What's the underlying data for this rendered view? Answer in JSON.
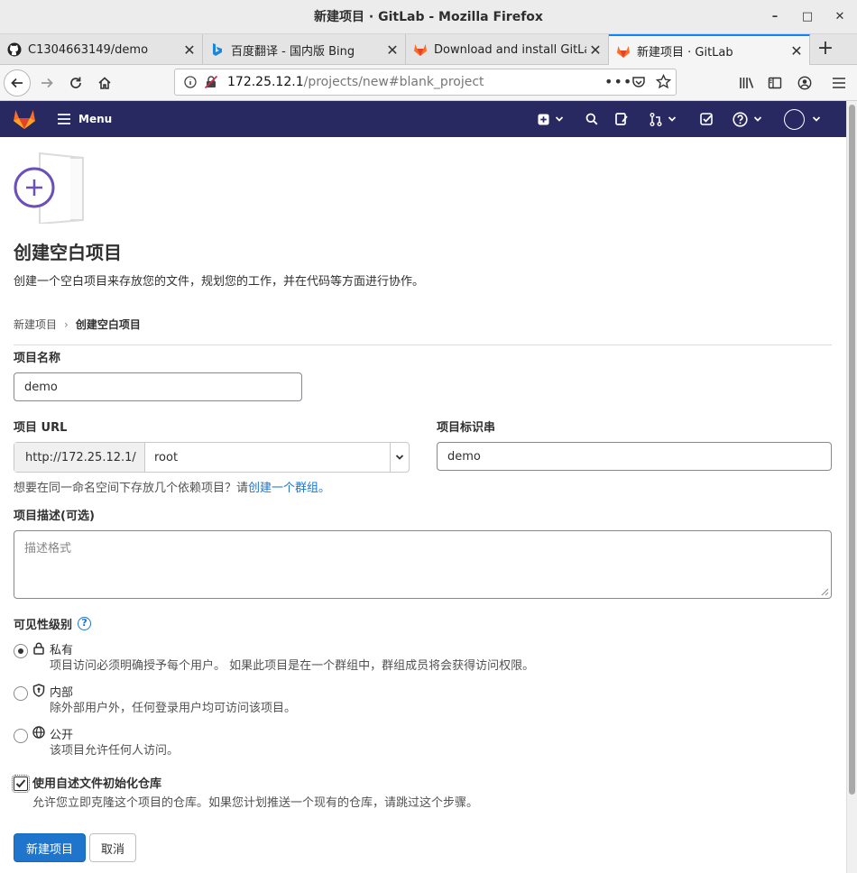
{
  "window": {
    "title": "新建项目 · GitLab - Mozilla Firefox"
  },
  "tabs": [
    {
      "label": "C1304663149/demo",
      "icon": "github-icon"
    },
    {
      "label": "百度翻译 - 国内版 Bing",
      "icon": "bing-icon"
    },
    {
      "label": "Download and install GitLab",
      "icon": "gitlab-icon"
    },
    {
      "label": "新建项目 · GitLab",
      "icon": "gitlab-icon",
      "active": true
    }
  ],
  "address": {
    "host": "172.25.12.1",
    "path": "/projects/new#blank_project"
  },
  "gitlab_header": {
    "menu_label": "Menu",
    "brand_color": "#292961",
    "logo_color": "#fc6d26"
  },
  "page": {
    "title": "创建空白项目",
    "description": "创建一个空白项目来存放您的文件，规划您的工作，并在代码等方面进行协作。",
    "breadcrumb": {
      "parent": "新建项目",
      "sep": "›",
      "current": "创建空白项目"
    }
  },
  "form": {
    "name_label": "项目名称",
    "name_value": "demo",
    "url_label": "项目 URL",
    "url_prefix": "http://172.25.12.1/",
    "namespace_value": "root",
    "slug_label": "项目标识串",
    "slug_value": "demo",
    "group_hint": "想要在同一命名空间下存放几个依赖项目？请",
    "group_link": "创建一个群组。",
    "desc_label": "项目描述(可选)",
    "desc_placeholder": "描述格式",
    "visibility_label": "可见性级别",
    "visibility_help": "?",
    "visibility_options": [
      {
        "title": "私有",
        "desc": "项目访问必须明确授予每个用户。 如果此项目是在一个群组中，群组成员将会获得访问权限。",
        "icon": "lock-icon",
        "checked": true
      },
      {
        "title": "内部",
        "desc": "除外部用户外，任何登录用户均可访问该项目。",
        "icon": "shield-icon",
        "checked": false
      },
      {
        "title": "公开",
        "desc": "该项目允许任何人访问。",
        "icon": "globe-icon",
        "checked": false
      }
    ],
    "init_readme_label": "使用自述文件初始化仓库",
    "init_readme_desc": "允许您立即克隆这个项目的仓库。如果您计划推送一个现有的仓库，请跳过这个步骤。",
    "init_readme_checked": true,
    "submit_label": "新建项目",
    "cancel_label": "取消",
    "accent_color": "#1f75cb"
  }
}
